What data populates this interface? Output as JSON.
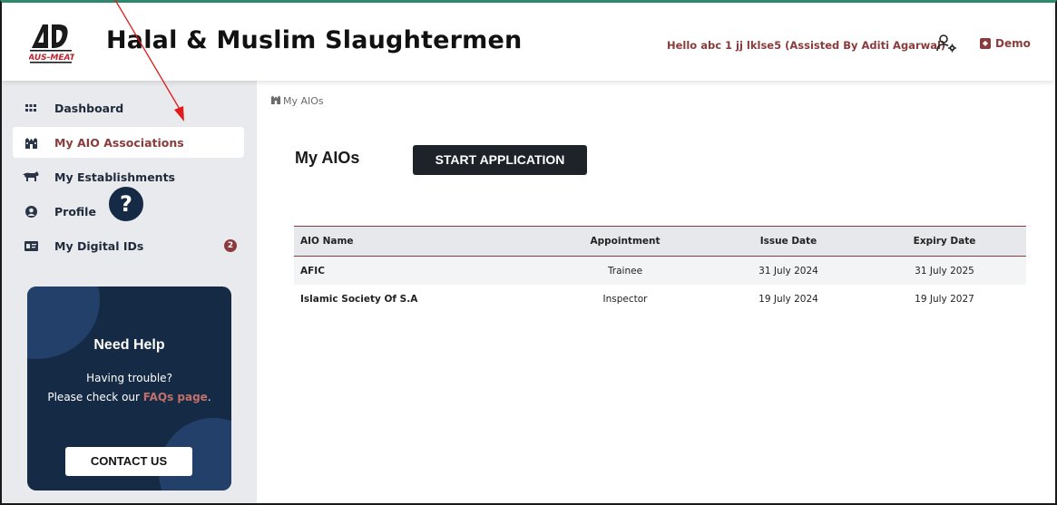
{
  "header": {
    "brand": "AUS-MEAT",
    "title": "Halal & Muslim Slaughtermen",
    "greeting": "Hello abc 1 jj lklse5 (Assisted By Aditi Agarwal)",
    "demo_label": "Demo"
  },
  "sidebar": {
    "items": [
      {
        "label": "Dashboard",
        "icon": "grid-icon"
      },
      {
        "label": "My AIO Associations",
        "icon": "building-icon",
        "active": true
      },
      {
        "label": "My Establishments",
        "icon": "cow-icon"
      },
      {
        "label": "Profile",
        "icon": "user-circle-icon"
      },
      {
        "label": "My Digital IDs",
        "icon": "id-card-icon",
        "badge": "2"
      }
    ],
    "help": {
      "title": "Need Help",
      "line1": "Having trouble?",
      "line2_prefix": "Please check our ",
      "link": "FAQs page",
      "line2_suffix": ".",
      "button": "CONTACT US"
    }
  },
  "main": {
    "breadcrumb": "My AIOs",
    "title": "My AIOs",
    "start_button": "START APPLICATION",
    "table": {
      "columns": [
        "AIO Name",
        "Appointment",
        "Issue Date",
        "Expiry Date"
      ],
      "rows": [
        [
          "AFIC",
          "Trainee",
          "31 July 2024",
          "31 July 2025"
        ],
        [
          "Islamic Society Of S.A",
          "Inspector",
          "19 July 2024",
          "19 July 2027"
        ]
      ]
    }
  },
  "colors": {
    "accent": "#8a3b3b",
    "sidebar_bg": "#e9eaee",
    "help_card": "#152a45",
    "button_dark": "#1e2329",
    "annotation": "#e01b1b"
  }
}
